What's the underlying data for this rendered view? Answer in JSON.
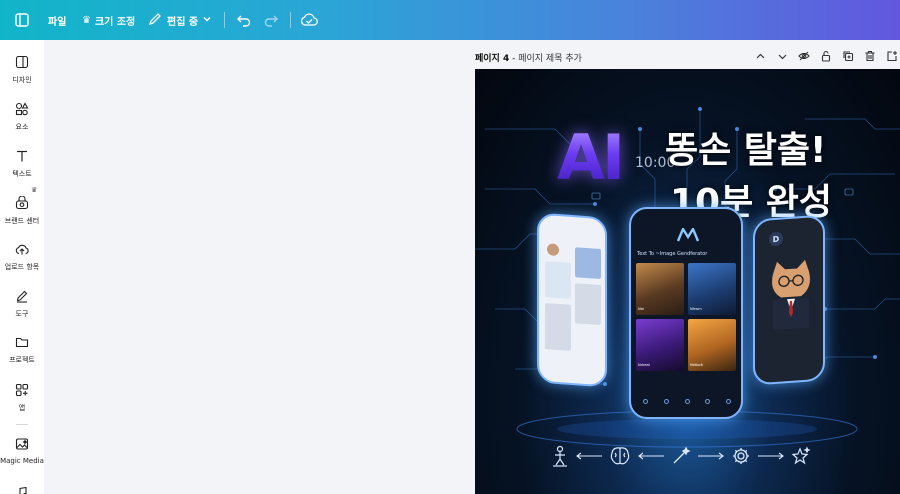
{
  "topbar": {
    "file_label": "파일",
    "resize_label": "크기 조정",
    "edit_mode_label": "편집 중"
  },
  "sidebar": {
    "items": [
      {
        "label": "디자인",
        "icon": "design-icon"
      },
      {
        "label": "요소",
        "icon": "elements-icon"
      },
      {
        "label": "텍스트",
        "icon": "text-icon"
      },
      {
        "label": "브랜드 센터",
        "icon": "brand-icon"
      },
      {
        "label": "업로드 항목",
        "icon": "upload-icon"
      },
      {
        "label": "도구",
        "icon": "draw-icon"
      },
      {
        "label": "프로젝트",
        "icon": "folder-icon"
      },
      {
        "label": "앱",
        "icon": "apps-icon"
      },
      {
        "label": "Magic Media",
        "icon": "magic-media-icon"
      }
    ]
  },
  "page": {
    "number_label": "페이지 4",
    "separator": " - ",
    "title_placeholder": "페이지 제목 추가"
  },
  "design": {
    "ai_text": "AI",
    "headline_line1": "똥손 탈출!",
    "headline_line2": "10분 완성",
    "clock": "10:00",
    "generator_title": "Text To ~Image Gendferator",
    "tile_labels": [
      "Ntn",
      "Nfrwrn",
      "Ndreat",
      "Nbtbolt"
    ]
  },
  "colors": {
    "topbar_start": "#11b5c9",
    "topbar_end": "#6257de",
    "workspace_bg": "#f3f4f8",
    "ai_purple": "#6c3cf2"
  }
}
